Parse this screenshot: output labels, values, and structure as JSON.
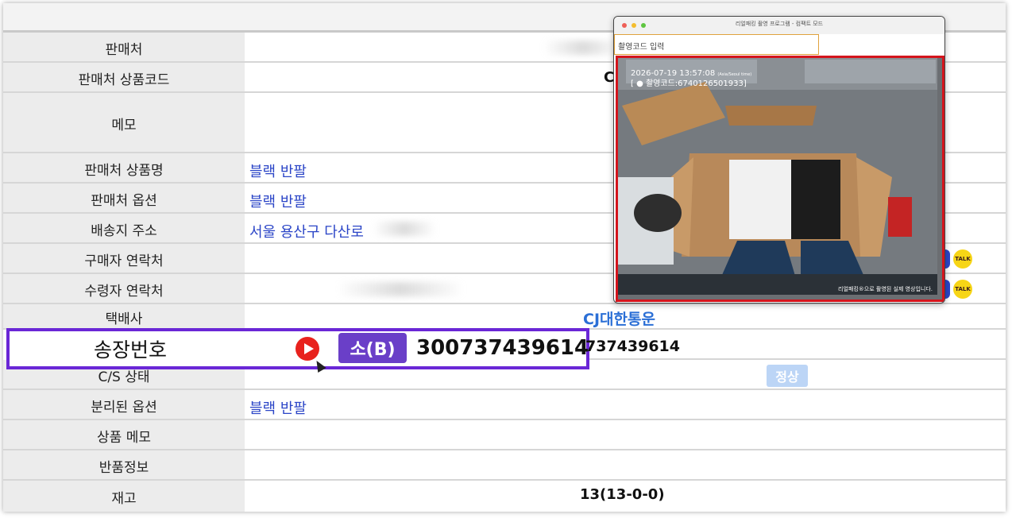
{
  "rows": [
    {
      "label": "판매처",
      "value": ""
    },
    {
      "label": "판매처 상품코드",
      "value": "C"
    },
    {
      "label": "메모",
      "value": ""
    },
    {
      "label": "판매처 상품명",
      "value": "블랙 반팔"
    },
    {
      "label": "판매처 옵션",
      "value": "블랙 반팔"
    },
    {
      "label": "배송지 주소",
      "value": "서울 용산구 다산로"
    },
    {
      "label": "구매자 연락처",
      "value": ""
    },
    {
      "label": "수령자 연락처",
      "value": ""
    },
    {
      "label": "택배사",
      "value": "CJ대한통운"
    },
    {
      "label": "송장번호",
      "value": "737439614"
    },
    {
      "label": "C/S 상태",
      "value": "정상"
    },
    {
      "label": "분리된 옵션",
      "value": "블랙 반팔"
    },
    {
      "label": "상품 메모",
      "value": ""
    },
    {
      "label": "반품정보",
      "value": ""
    },
    {
      "label": "재고",
      "value": "13(13-0-0)"
    }
  ],
  "invoice": {
    "size_badge": "소(B)",
    "number": "300737439614"
  },
  "kakao_label": "TALK",
  "popup": {
    "title": "리얼패킹 촬영 프로그램 - 컴팩트 모드",
    "code_placeholder": "촬영코드 입력",
    "controls": [
      {
        "icon": "stop-icon",
        "glyph": "■",
        "color": "#5aa0b8"
      },
      {
        "icon": "close-icon",
        "glyph": "✕",
        "color": "#e8221d"
      },
      {
        "icon": "pause-icon",
        "glyph": "❚❚",
        "color": "#3d3dd6"
      },
      {
        "icon": "history-icon",
        "glyph": "↺",
        "color": "#f05a4a"
      },
      {
        "icon": "expand-icon",
        "glyph": "⤢",
        "color": "#0f4f4a"
      }
    ],
    "timestamp": "2026-07-19 13:57:08",
    "timezone": "(Asia/Seoul time)",
    "record_code": "[ ● 촬영코드:6740126501933]",
    "caption": "리얼패킹®으로 촬영된 실제 영상입니다."
  }
}
